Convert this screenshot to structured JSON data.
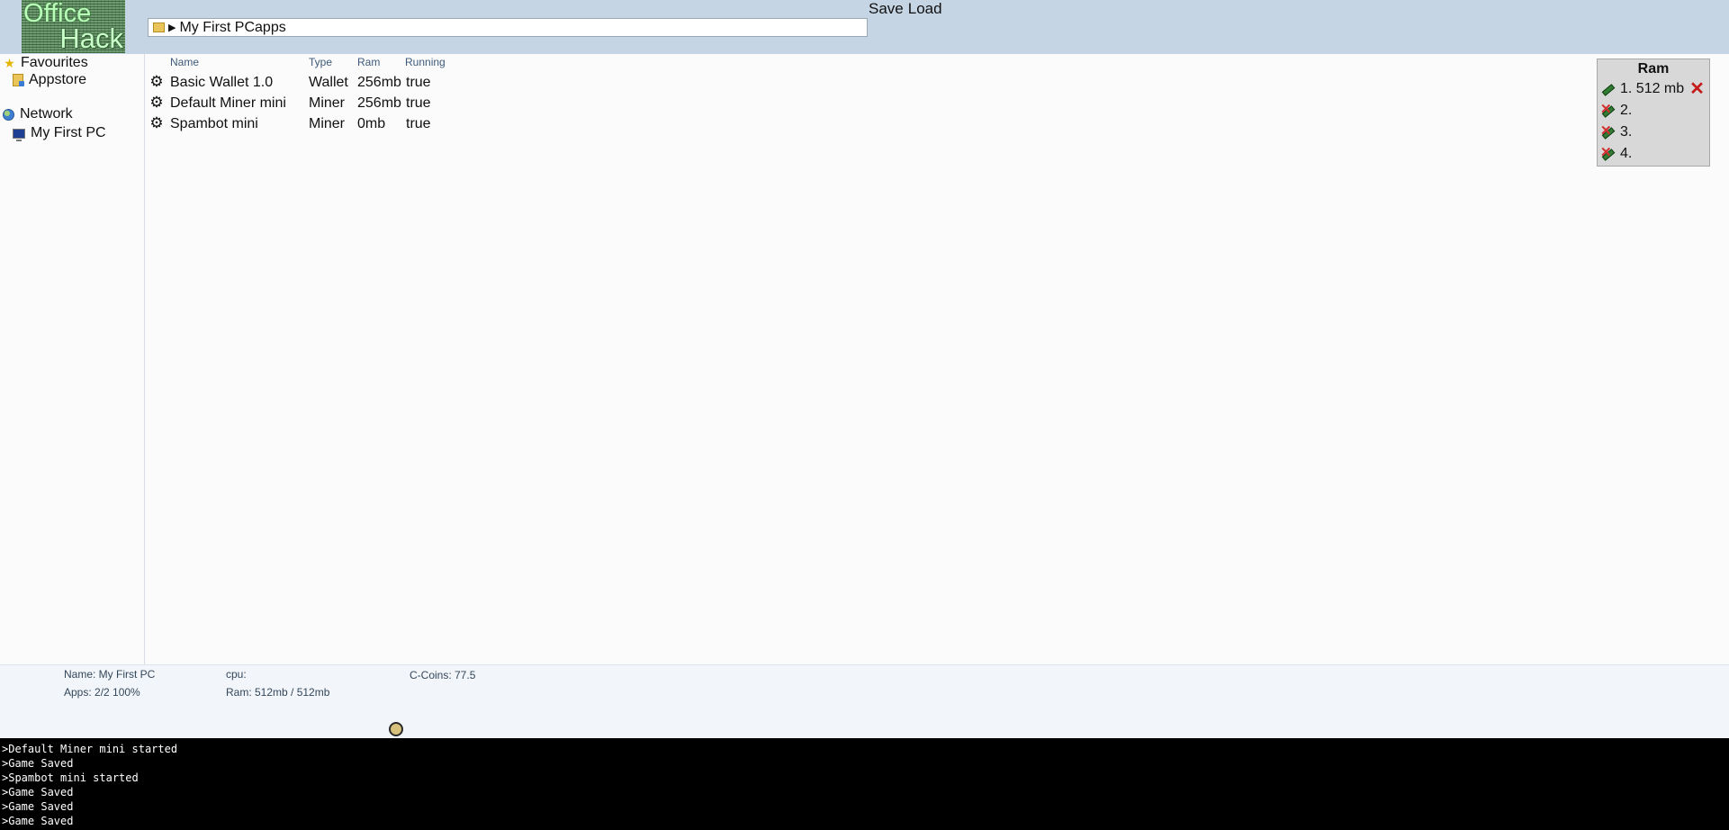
{
  "header": {
    "logo_line1": "Office",
    "logo_line2": "Hack",
    "path_location": "My First PCapps",
    "save_label": "Save",
    "load_label": "Load"
  },
  "sidebar": {
    "favourites_label": "Favourites",
    "appstore_label": "Appstore",
    "network_label": "Network",
    "pc_label": "My First PC"
  },
  "apps": {
    "columns": [
      "Name",
      "Type",
      "Ram",
      "Running"
    ],
    "rows": [
      {
        "name": "Basic Wallet 1.0",
        "type": "Wallet",
        "ram": "256mb",
        "running": "true"
      },
      {
        "name": "Default Miner mini",
        "type": "Miner",
        "ram": "256mb",
        "running": "true"
      },
      {
        "name": "Spambot mini",
        "type": "Miner",
        "ram": "0mb",
        "running": "true"
      }
    ]
  },
  "ram_panel": {
    "title": "Ram",
    "slots": [
      {
        "label": "1. 512 mb",
        "installed": true
      },
      {
        "label": "2.",
        "installed": false
      },
      {
        "label": "3.",
        "installed": false
      },
      {
        "label": "4.",
        "installed": false
      }
    ]
  },
  "status": {
    "name": "Name: My First PC",
    "apps": "Apps: 2/2 100%",
    "cpu": "cpu:",
    "ram": "Ram: 512mb / 512mb",
    "coins": "C-Coins: 77.5"
  },
  "console": {
    "lines": [
      ">Default Miner mini started",
      ">Game Saved",
      ">Spambot mini started",
      ">Game Saved",
      ">Game Saved",
      ">Game Saved"
    ]
  },
  "colors": {
    "header_bg": "#c6d5e4",
    "console_bg": "#000000",
    "remove_red": "#c41b1b"
  }
}
